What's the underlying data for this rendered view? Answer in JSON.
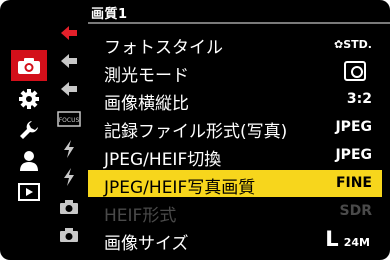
{
  "header": {
    "title": "画質1"
  },
  "left_tabs": [
    {
      "name": "camera",
      "icon": "camera-icon",
      "active": true
    },
    {
      "name": "gear",
      "icon": "gear-icon",
      "active": false
    },
    {
      "name": "wrench",
      "icon": "wrench-icon",
      "active": false
    },
    {
      "name": "person",
      "icon": "person-icon",
      "active": false
    },
    {
      "name": "playback",
      "icon": "playback-icon",
      "active": false
    }
  ],
  "sub_tabs": [
    {
      "icon": "pointer-red-icon",
      "active": true
    },
    {
      "icon": "pointer-gray-icon",
      "active": false
    },
    {
      "icon": "pointer-gray-icon",
      "active": false
    },
    {
      "icon": "focus-badge-icon",
      "label": "FOCUS",
      "active": false
    },
    {
      "icon": "flash-icon",
      "active": false
    },
    {
      "icon": "flash-icon",
      "active": false
    },
    {
      "icon": "camera-small-icon",
      "active": false
    },
    {
      "icon": "camera-small-icon",
      "active": false
    }
  ],
  "menu": {
    "items": [
      {
        "label": "フォトスタイル",
        "value": "STD.",
        "value_prefix": "✿"
      },
      {
        "label": "測光モード",
        "value": "",
        "value_icon": "metering-icon"
      },
      {
        "label": "画像横縦比",
        "value": "3:2"
      },
      {
        "label": "記録ファイル形式(写真)",
        "value": "JPEG"
      },
      {
        "label": "JPEG/HEIF切換",
        "value": "JPEG"
      },
      {
        "label": "JPEG/HEIF写真画質",
        "value": "FINE",
        "selected": true
      },
      {
        "label": "HEIF形式",
        "value": "SDR",
        "disabled": true
      },
      {
        "label": "画像サイズ",
        "value_big": "L",
        "value_small": "24M"
      }
    ]
  },
  "colors": {
    "active_tab": "#d30f1a",
    "highlight": "#f7d61c",
    "disabled_text": "#4a4a4a"
  }
}
